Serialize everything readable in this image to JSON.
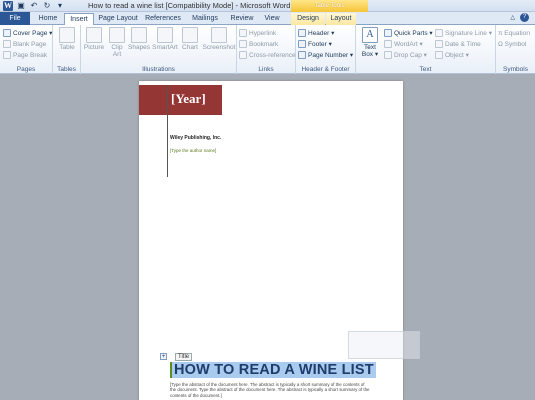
{
  "window": {
    "title": "How to read a wine list [Compatibility Mode] - Microsoft Word",
    "context_tab_group": "Table Tools"
  },
  "qat": {
    "icons": [
      "word-icon",
      "save-icon",
      "undo-icon",
      "redo-icon",
      "customize-icon"
    ]
  },
  "tabs": [
    {
      "label": "File"
    },
    {
      "label": "Home"
    },
    {
      "label": "Insert"
    },
    {
      "label": "Page Layout"
    },
    {
      "label": "References"
    },
    {
      "label": "Mailings"
    },
    {
      "label": "Review"
    },
    {
      "label": "View"
    },
    {
      "label": "Design"
    },
    {
      "label": "Layout"
    }
  ],
  "active_tab": "Insert",
  "ribbon": {
    "pages": {
      "label": "Pages",
      "cover_page": "Cover Page",
      "blank_page": "Blank Page",
      "page_break": "Page Break"
    },
    "tables": {
      "label": "Tables",
      "table": "Table"
    },
    "illustrations": {
      "label": "Illustrations",
      "picture": "Picture",
      "clip_art_1": "Clip",
      "clip_art_2": "Art",
      "shapes": "Shapes",
      "smartart": "SmartArt",
      "chart": "Chart",
      "screenshot": "Screenshot"
    },
    "links": {
      "label": "Links",
      "hyperlink": "Hyperlink",
      "bookmark": "Bookmark",
      "cross_reference": "Cross-reference"
    },
    "header_footer": {
      "label": "Header & Footer",
      "header": "Header",
      "footer": "Footer",
      "page_number": "Page Number"
    },
    "text": {
      "label": "Text",
      "text_box_1": "Text",
      "text_box_2": "Box",
      "quick_parts": "Quick Parts",
      "wordart": "WordArt",
      "drop_cap": "Drop Cap",
      "signature_line": "Signature Line",
      "date_time": "Date & Time",
      "object": "Object"
    },
    "symbols": {
      "label": "Symbols",
      "equation": "Equation",
      "symbol": "Symbol"
    }
  },
  "document": {
    "year_placeholder": "[Year]",
    "company": "Wiley Publishing, Inc.",
    "author_placeholder": "[Type the author name]",
    "title_tag": "Title",
    "title": "HOW TO READ A WINE LIST",
    "abstract": "[Type the abstract of the document here. The abstract is typically a short summary of the contents of the document. Type the abstract of the document here. The abstract is typically a short summary of the contents of the document.]"
  },
  "colors": {
    "file_tab": "#2b5797",
    "year_bar": "#943634",
    "title_highlight": "#a9cbee",
    "context_tab": "#f6c437"
  }
}
